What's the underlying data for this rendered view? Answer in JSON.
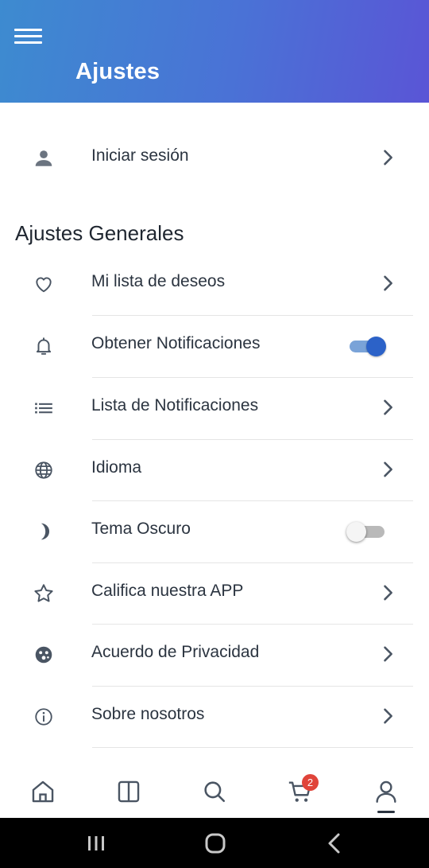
{
  "header": {
    "title": "Ajustes",
    "menu_icon": "hamburger-menu-icon",
    "gradient_start": "#3d8bd0",
    "gradient_end": "#5a55d6"
  },
  "login": {
    "label": "Iniciar sesión",
    "icon": "person-icon"
  },
  "general": {
    "title": "Ajustes Generales",
    "items": [
      {
        "label": "Mi lista de deseos",
        "icon": "heart-icon",
        "control": "chevron"
      },
      {
        "label": "Obtener Notificaciones",
        "icon": "bell-icon",
        "control": "toggle",
        "enabled": true
      },
      {
        "label": "Lista de Notificaciones",
        "icon": "list-icon",
        "control": "chevron"
      },
      {
        "label": "Idioma",
        "icon": "globe-icon",
        "control": "chevron"
      },
      {
        "label": "Tema Oscuro",
        "icon": "moon-icon",
        "control": "toggle",
        "enabled": false
      },
      {
        "label": "Califica nuestra APP",
        "icon": "star-icon",
        "control": "chevron"
      },
      {
        "label": "Acuerdo de Privacidad",
        "icon": "privacy-icon",
        "control": "chevron"
      },
      {
        "label": "Sobre nosotros",
        "icon": "info-icon",
        "control": "chevron"
      }
    ]
  },
  "bottom_nav": {
    "items": [
      {
        "name": "home",
        "icon": "home-icon"
      },
      {
        "name": "categories",
        "icon": "columns-icon"
      },
      {
        "name": "search",
        "icon": "search-icon"
      },
      {
        "name": "cart",
        "icon": "cart-icon",
        "badge": "2"
      },
      {
        "name": "profile",
        "icon": "user-icon",
        "active": true
      }
    ],
    "badge_color": "#e0443a"
  },
  "system_bar": {
    "buttons": [
      "recents-icon",
      "home-circle-icon",
      "back-icon"
    ]
  },
  "colors": {
    "accent": "#2c62c8",
    "text": "#2b3440",
    "icon": "#4a5563"
  }
}
